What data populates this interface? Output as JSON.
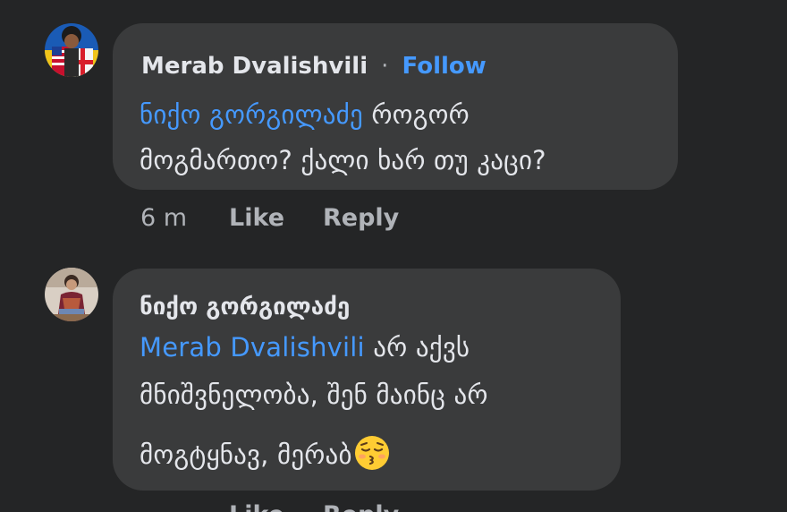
{
  "comments": [
    {
      "author": "Merab Dvalishvili",
      "separator": "·",
      "follow_label": "Follow",
      "mention": "ნიქო გორგილაძე",
      "line1_rest": " როგორ",
      "line2": "მოგმართო? ქალი ხარ თუ კაცი?",
      "time": "6 m",
      "like_label": "Like",
      "reply_label": "Reply"
    },
    {
      "author": "ნიქო გორგილაძე",
      "mention": "Merab Dvalishvili",
      "line1_rest": " არ აქვს",
      "line2": "მნიშვნელობა, შენ მაინც არ",
      "line3": "მოგტყნავ, მერაბ",
      "emoji": "kissing-face-with-closed-eyes",
      "like_label": "Like",
      "reply_label": "Reply"
    }
  ],
  "colors": {
    "background": "#242526",
    "bubble": "#3a3b3c",
    "text": "#e4e6eb",
    "secondary_text": "#b0b3b8",
    "link": "#4599ff"
  }
}
